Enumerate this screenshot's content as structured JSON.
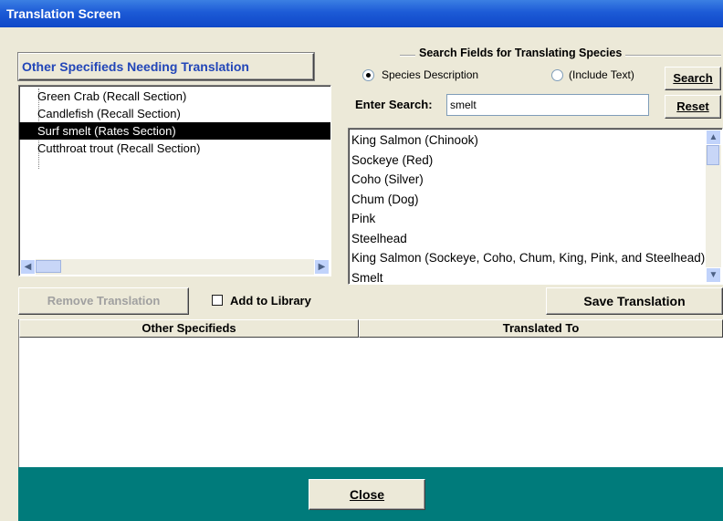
{
  "window": {
    "title": "Translation Screen"
  },
  "left_panel": {
    "header": "Other Specifieds Needing Translation",
    "items": [
      {
        "label": "Green Crab  (Recall Section)"
      },
      {
        "label": "Candlefish  (Recall Section)"
      },
      {
        "label": "Surf smelt  (Rates Section)",
        "selected": true
      },
      {
        "label": "Cutthroat trout  (Recall Section)"
      }
    ]
  },
  "search": {
    "group_title": "Search Fields for Translating Species",
    "radio_species": "Species Description",
    "radio_species_selected": true,
    "radio_include": "(Include Text)",
    "radio_include_selected": false,
    "search_button": "Search",
    "reset_button": "Reset",
    "enter_label": "Enter Search:",
    "input_value": "smelt"
  },
  "results": [
    "King Salmon (Chinook)",
    "Sockeye (Red)",
    "Coho (Silver)",
    "Chum (Dog)",
    "Pink",
    "Steelhead",
    "King Salmon (Sockeye, Coho, Chum, King, Pink, and Steelhead)",
    "Smelt"
  ],
  "actions": {
    "remove_translation": "Remove Translation",
    "add_to_library": "Add to Library",
    "add_to_library_checked": false,
    "save_translation": "Save Translation"
  },
  "table": {
    "columns": [
      "Other Specifieds",
      "Translated To"
    ],
    "rows": []
  },
  "footer": {
    "close_button": "Close"
  },
  "colors": {
    "title_bar": "#0f48c8",
    "footer": "#007b7b",
    "header_text": "#2246b8"
  }
}
